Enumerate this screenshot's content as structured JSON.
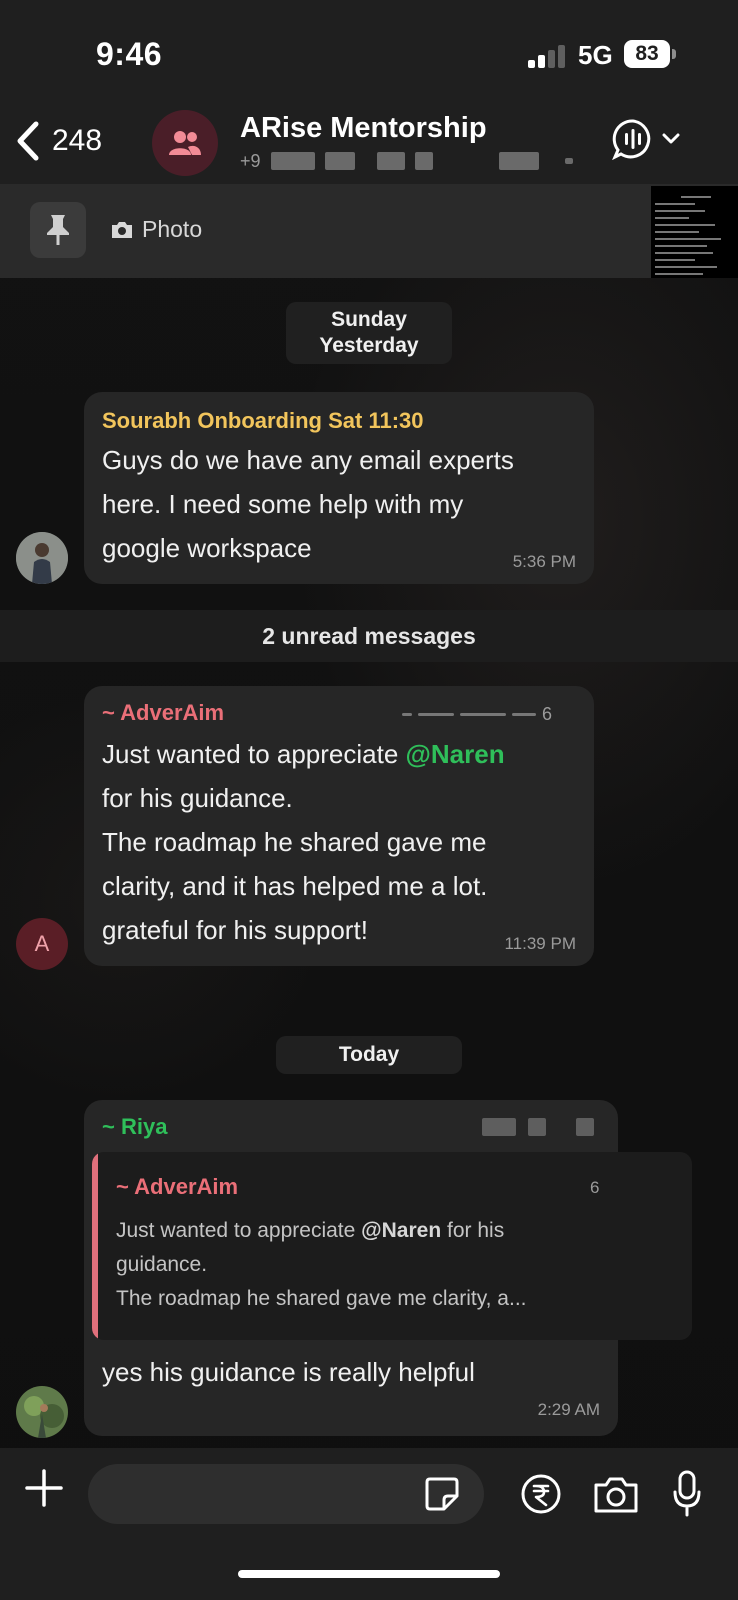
{
  "status_bar": {
    "time": "9:46",
    "network": "5G",
    "battery": "83"
  },
  "header": {
    "back_count": "248",
    "group_name": "ARise Mentorship",
    "subtitle_prefix": "+9"
  },
  "pinned": {
    "label": "Photo"
  },
  "chips": {
    "day1_line1": "Sunday",
    "day1_line2": "Yesterday",
    "today": "Today"
  },
  "messages": [
    {
      "sender": "Sourabh Onboarding Sat 11:30",
      "sender_color": "#f2c55c",
      "lines": [
        "Guys do we have any email experts",
        "here. I need some help with my",
        "google workspace"
      ],
      "time": "5:36 PM"
    },
    {
      "sender": "~ AdverAim",
      "sender_color": "#ea6f78",
      "phone_suffix": "6",
      "line1_prefix": "Just wanted to appreciate ",
      "mention": "@Naren",
      "mention_color": "#2fbf5a",
      "lines": [
        "for his guidance.",
        "The roadmap he shared gave me",
        "clarity, and it has helped me a lot.",
        "grateful for his support!"
      ],
      "time": "11:39 PM",
      "avatar_letter": "A"
    },
    {
      "sender": "~ Riya",
      "sender_color": "#2fbf5a",
      "quote": {
        "sender": "~ AdverAim",
        "suffix": "6",
        "line1_prefix": "Just wanted to appreciate ",
        "line1_mention": "@Naren",
        "line1_suffix": " for his",
        "line2": "guidance.",
        "line3": "The roadmap he shared gave me  clarity, a..."
      },
      "text": "yes his guidance is really helpful",
      "time": "2:29 AM"
    }
  ],
  "unread_label": "2 unread messages",
  "icons": [
    "chevron-left-icon",
    "group-icon",
    "audio-call-icon",
    "chevron-down-icon",
    "pin-icon",
    "camera-icon",
    "plus-icon",
    "sticker-icon",
    "rupee-icon",
    "mic-icon"
  ]
}
